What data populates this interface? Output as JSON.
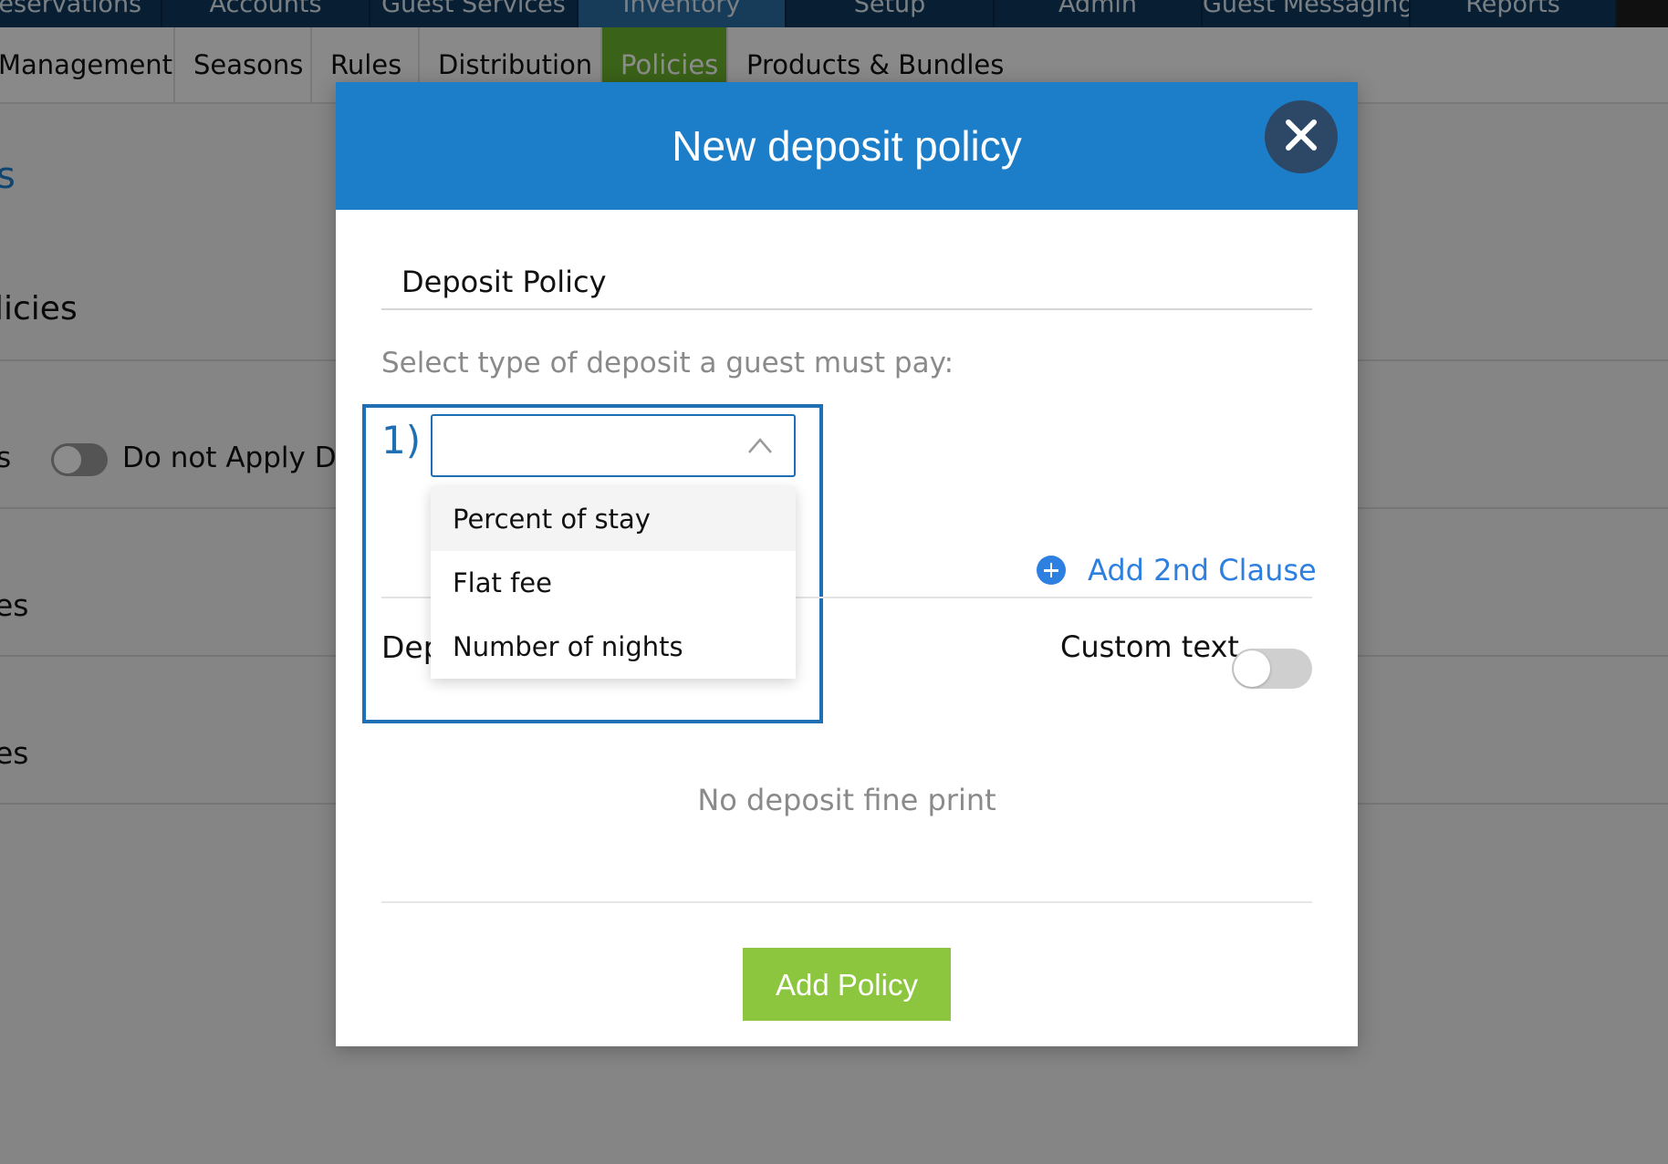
{
  "top_nav": {
    "tabs": [
      "Reservations",
      "Accounts",
      "Guest Services",
      "Inventory",
      "Setup",
      "Admin",
      "Guest Messaging",
      "Reports"
    ],
    "active_tab": "Inventory"
  },
  "sub_nav": {
    "tabs": [
      "Management",
      "Seasons",
      "Rules",
      "Distribution",
      "Policies",
      "Products & Bundles"
    ],
    "active_tab": "Policies"
  },
  "background": {
    "heading": "s",
    "section_title": "licies",
    "row1_label": "s",
    "toggle_label": "Do not Apply Dep",
    "row2_label": "es",
    "row3_label": "es"
  },
  "modal": {
    "title": "New deposit policy",
    "policy_name": "Deposit Policy",
    "prompt": "Select type of deposit a guest must pay:",
    "clause_number": "1)",
    "select_value": "",
    "dropdown_options": [
      "Percent of stay",
      "Flat fee",
      "Number of nights"
    ],
    "add_clause_label": "Add 2nd Clause",
    "deposit_label": "Dep",
    "custom_text_label": "Custom text",
    "custom_text_enabled": false,
    "fine_print": "No deposit fine print",
    "submit_label": "Add Policy"
  },
  "colors": {
    "header_blue": "#1c7ec8",
    "accent_blue": "#2d7fe0",
    "highlight_border": "#1f6fb5",
    "close_button": "#2c4866",
    "submit_green": "#8cc63f",
    "active_subtab_green": "#6bb22c"
  }
}
